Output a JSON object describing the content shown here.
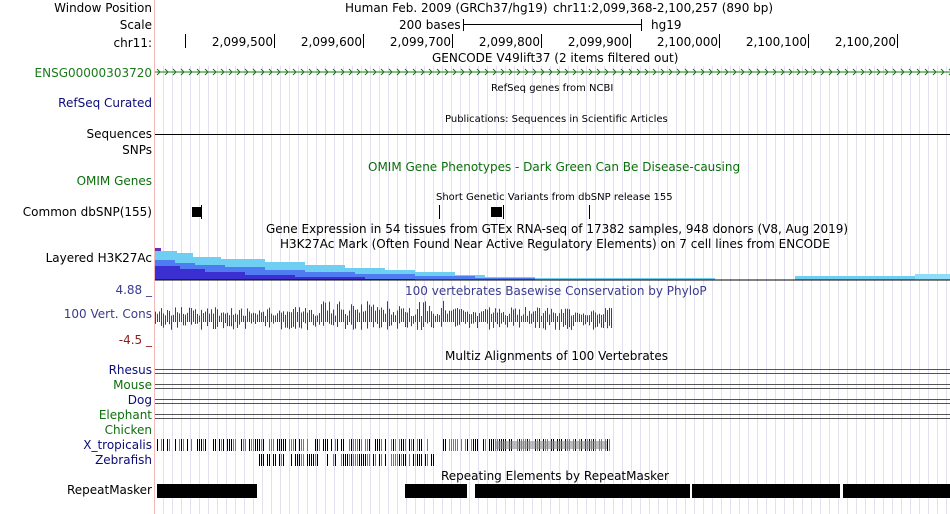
{
  "left": {
    "window_position": "Window Position",
    "scale": "Scale",
    "chrom": "chr11:",
    "ensg": "ENSG00000303720",
    "refseq": "RefSeq Curated",
    "sequences": "Sequences",
    "snps": "SNPs",
    "omim": "OMIM Genes",
    "dbsnp": "Common dbSNP(155)",
    "layered": "Layered H3K27Ac",
    "cons_max": "4.88 _",
    "cons_label": "100 Vert. Cons",
    "cons_min": "-4.5 _",
    "species": [
      "Rhesus",
      "Mouse",
      "Dog",
      "Elephant",
      "Chicken",
      "X_tropicalis",
      "Zebrafish"
    ],
    "repeatmasker": "RepeatMasker"
  },
  "header": {
    "assembly": "Human Feb. 2009 (GRCh37/hg19)",
    "position": "chr11:2,099,368-2,100,257 (890 bp)",
    "scale_text": "200 bases",
    "scale_db": "hg19",
    "coordinates": [
      "2,099,500",
      "2,099,600",
      "2,099,700",
      "2,099,800",
      "2,099,900",
      "2,100,000",
      "2,100,100",
      "2,100,200"
    ]
  },
  "tracks": {
    "gencode": "GENCODE V49lift37 (2 items filtered out)",
    "refseq": "RefSeq genes from NCBI",
    "publications": "Publications: Sequences in Scientific Articles",
    "omim": "OMIM Gene Phenotypes - Dark Green Can Be Disease-causing",
    "dbsnp": "Short Genetic Variants from dbSNP release 155",
    "gtex": "Gene Expression in 54 tissues from GTEx RNA-seq of 17382 samples, 948 donors (V8, Aug 2019)",
    "h3k27ac": "H3K27Ac Mark (Often Found Near Active Regulatory Elements) on 7 cell lines from ENCODE",
    "phylop": "100 vertebrates Basewise Conservation by PhyloP",
    "multiz": "Multiz Alignments of 100 Vertebrates",
    "repeatmasker": "Repeating Elements by RepeatMasker"
  },
  "colors": {
    "gencode": "#1a7a1a",
    "refseq_label": "#0c0c78",
    "omim": "#0b6e0b",
    "cons": "#3b3b8f",
    "cons_neg": "#8f1d1d",
    "h3_light": "#6ecff2",
    "h3_mid": "#4f7cf0",
    "h3_dark": "#3b2fd2"
  }
}
